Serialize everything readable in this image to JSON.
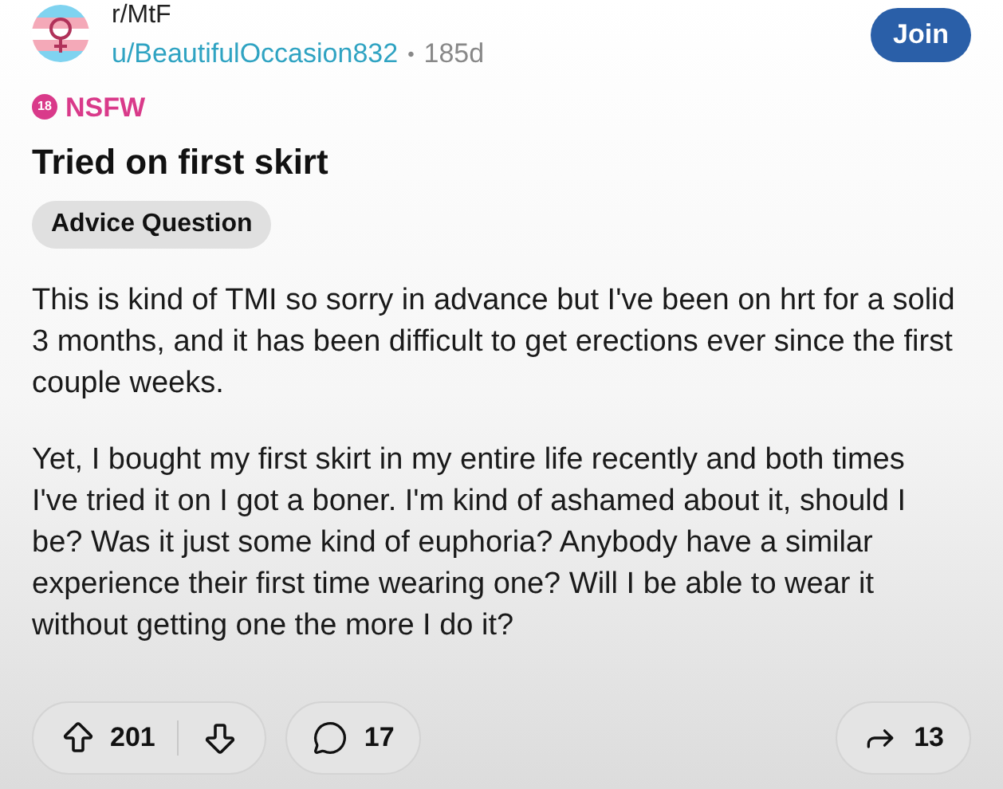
{
  "post": {
    "subreddit": "r/MtF",
    "author": "u/BeautifulOccasion832",
    "separator": "•",
    "age": "185d",
    "join_label": "Join",
    "nsfw_label": "NSFW",
    "nsfw_badge": "18",
    "title": "Tried on first skirt",
    "flair": "Advice Question",
    "paragraphs": [
      "This is kind of TMI so sorry in advance but I've been on hrt for a solid 3 months, and it has been difficult to get erections ever since the first couple weeks.",
      "Yet, I bought my first skirt in my entire life recently and both times I've tried it on I got a boner. I'm kind of ashamed about it, should I be? Was it just some kind of euphoria? Anybody have a similar experience their first time wearing one? Will I be able to wear it without getting one the more I do it?"
    ]
  },
  "actions": {
    "upvotes": "201",
    "comments": "17",
    "shares": "13"
  }
}
